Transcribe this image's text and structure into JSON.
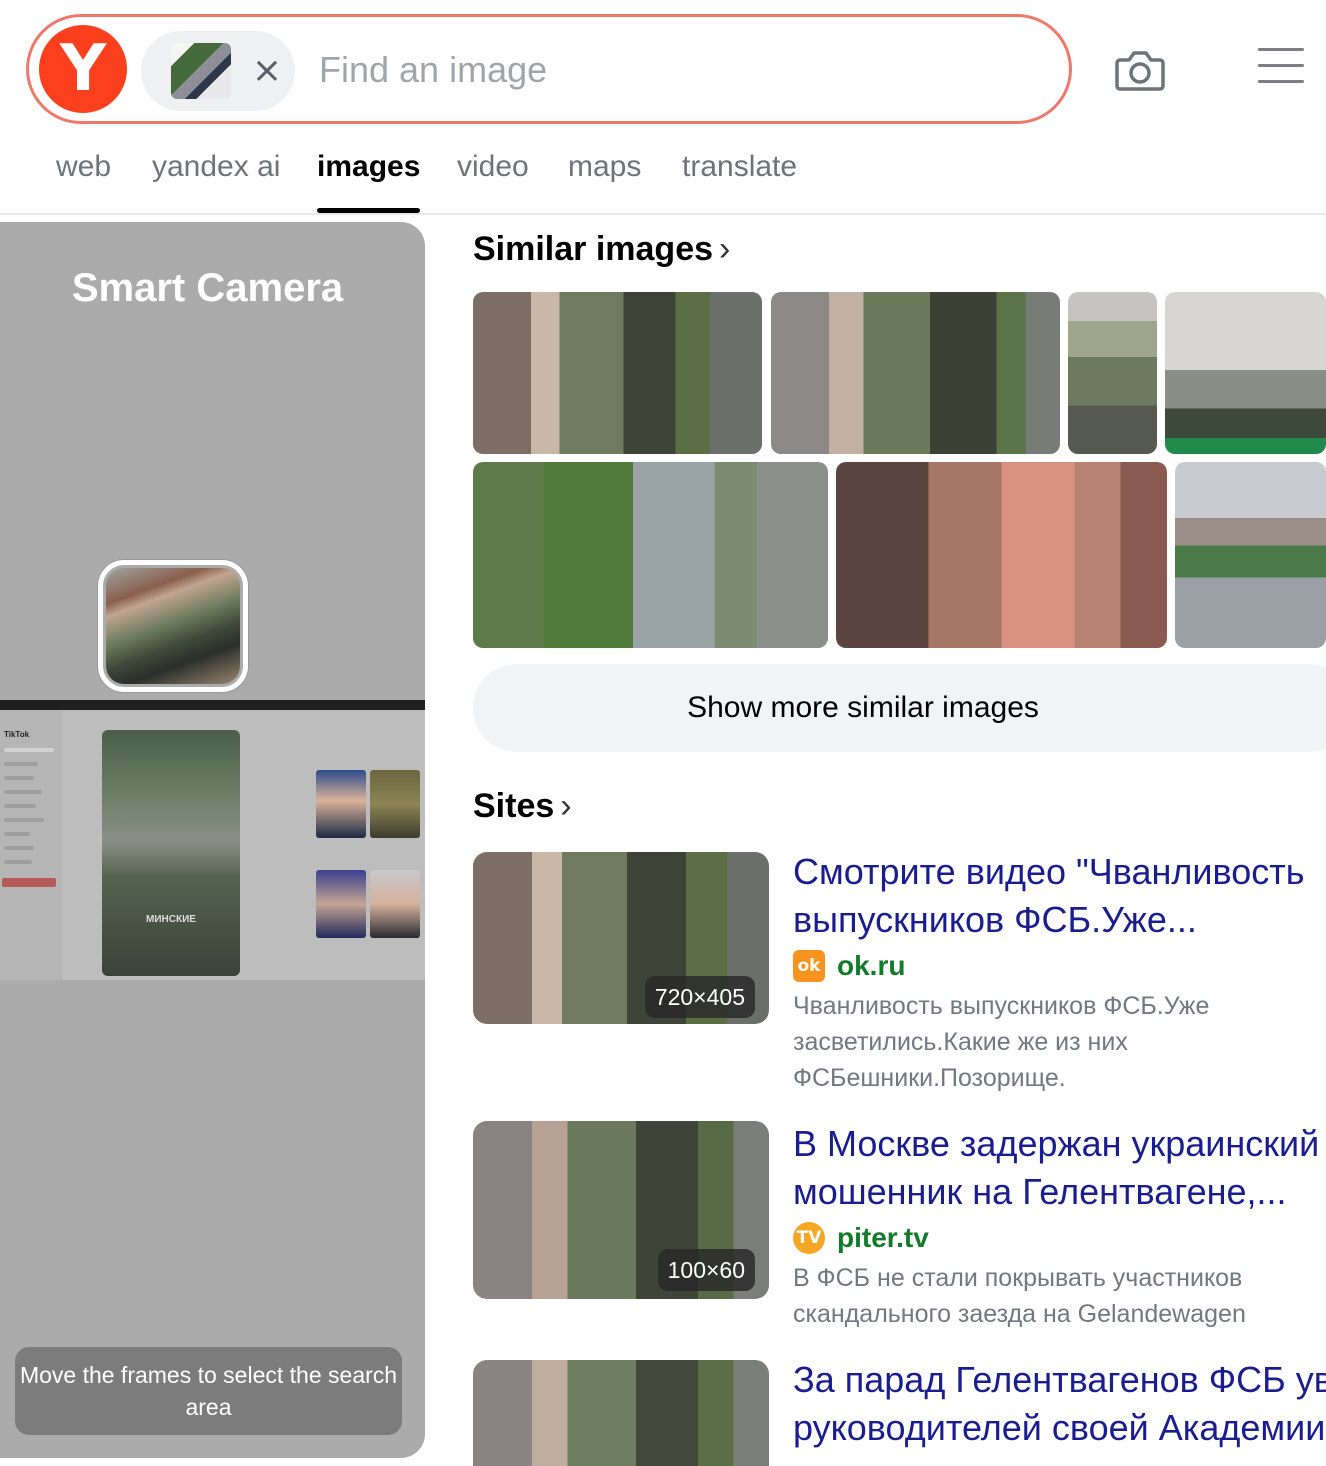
{
  "search": {
    "logo_letter": "Y",
    "close_glyph": "×",
    "placeholder": "Find an image"
  },
  "icons": {
    "camera": "camera-icon",
    "menu": "hamburger-menu-icon",
    "chevron": "chevron-right-icon",
    "close": "close-icon"
  },
  "colors": {
    "brand_red": "#fc3f1d",
    "search_border": "#f0786a",
    "link_blue": "#1a1d8f",
    "host_green": "#137a2a"
  },
  "tabs": [
    {
      "label": "web",
      "active": false
    },
    {
      "label": "yandex ai",
      "active": false
    },
    {
      "label": "images",
      "active": true
    },
    {
      "label": "video",
      "active": false
    },
    {
      "label": "maps",
      "active": false
    },
    {
      "label": "translate",
      "active": false
    }
  ],
  "smart_camera": {
    "title": "Smart Camera",
    "shot_app": "TikTok",
    "shot_caption": "МИНСКИЕ",
    "hint": "Move the frames to select the search area"
  },
  "similar": {
    "title": "Similar images",
    "chevron": "›",
    "more_label": "Show more similar images"
  },
  "sites": {
    "title": "Sites",
    "chevron": "›",
    "items": [
      {
        "title_line1": "Смотрите видео \"Чванливость",
        "title_line2": "выпускников ФСБ.Уже...",
        "favicon": "ok",
        "host": "ok.ru",
        "dimensions": "720×405",
        "snippet": "Чванливость выпускников ФСБ.Уже засветились.Какие же из них ФСБешники.Позорище."
      },
      {
        "title_line1": "В Москве задержан украинский",
        "title_line2": "мошенник на Гелентвагене,...",
        "favicon": "TV",
        "host": "piter.tv",
        "dimensions": "100×60",
        "snippet": "В ФСБ не стали покрывать участников скандального заезда на Gelandewagen"
      },
      {
        "title_line1": "За парад Гелентвагенов ФСБ ув",
        "title_line2": "руководителей своей Академии"
      }
    ]
  }
}
